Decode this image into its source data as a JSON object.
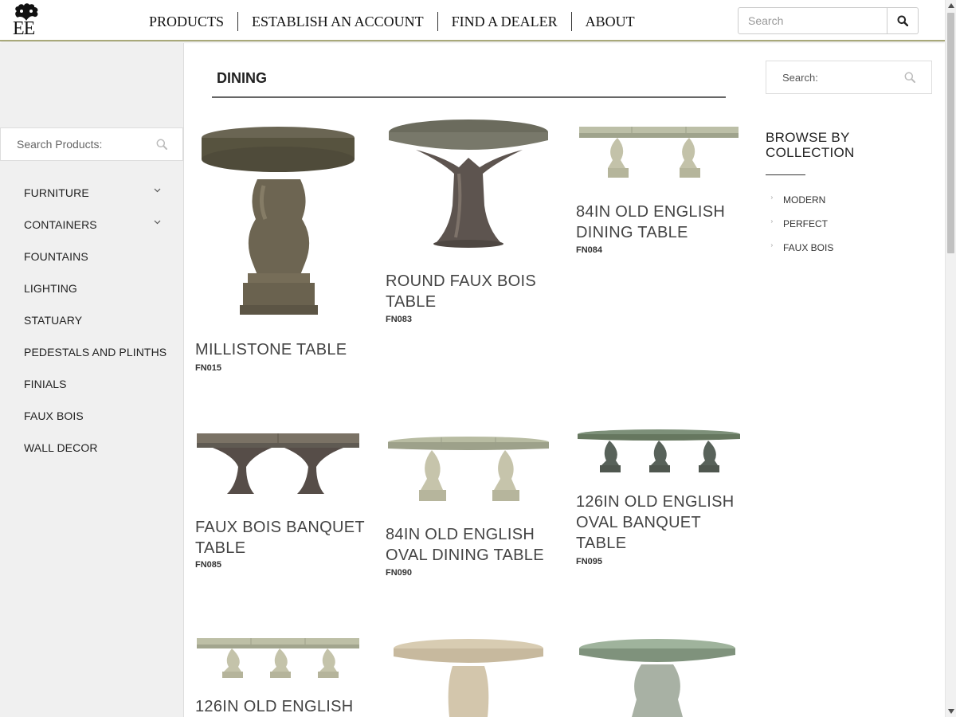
{
  "header": {
    "logo_text": "EE",
    "nav": [
      "PRODUCTS",
      "ESTABLISH AN ACCOUNT",
      "FIND A DEALER",
      "ABOUT"
    ],
    "search_placeholder": "Search"
  },
  "sidebar": {
    "search_placeholder": "Search Products:",
    "items": [
      {
        "label": "FURNITURE",
        "has_children": true
      },
      {
        "label": "CONTAINERS",
        "has_children": true
      },
      {
        "label": "FOUNTAINS",
        "has_children": false
      },
      {
        "label": "LIGHTING",
        "has_children": false
      },
      {
        "label": "STATUARY",
        "has_children": false
      },
      {
        "label": "PEDESTALS AND PLINTHS",
        "has_children": false
      },
      {
        "label": "FINIALS",
        "has_children": false
      },
      {
        "label": "FAUX BOIS",
        "has_children": false
      },
      {
        "label": "WALL DECOR",
        "has_children": false
      }
    ]
  },
  "main": {
    "title": "DINING",
    "products": [
      {
        "name": "MILLISTONE TABLE",
        "sku": "FN015"
      },
      {
        "name": "ROUND FAUX BOIS TABLE",
        "sku": "FN083"
      },
      {
        "name": "84IN OLD ENGLISH DINING TABLE",
        "sku": "FN084"
      },
      {
        "name": "FAUX BOIS BANQUET TABLE",
        "sku": "FN085"
      },
      {
        "name": "84IN OLD ENGLISH OVAL DINING TABLE",
        "sku": "FN090"
      },
      {
        "name": "126IN OLD ENGLISH OVAL BANQUET TABLE",
        "sku": "FN095"
      },
      {
        "name": "126IN OLD ENGLISH",
        "sku": ""
      },
      {
        "name": "",
        "sku": ""
      },
      {
        "name": "",
        "sku": ""
      }
    ]
  },
  "right": {
    "search_placeholder": "Search:",
    "browse_title": "BROWSE BY COLLECTION",
    "collections": [
      "MODERN",
      "PERFECT",
      "FAUX BOIS"
    ]
  },
  "colors": {
    "header_rule": "#a9a97a",
    "sidebar_bg": "#f0f0f0",
    "stone_dark": "#5d5a4c",
    "stone_light": "#bdbfa6",
    "stone_green": "#95a895"
  }
}
